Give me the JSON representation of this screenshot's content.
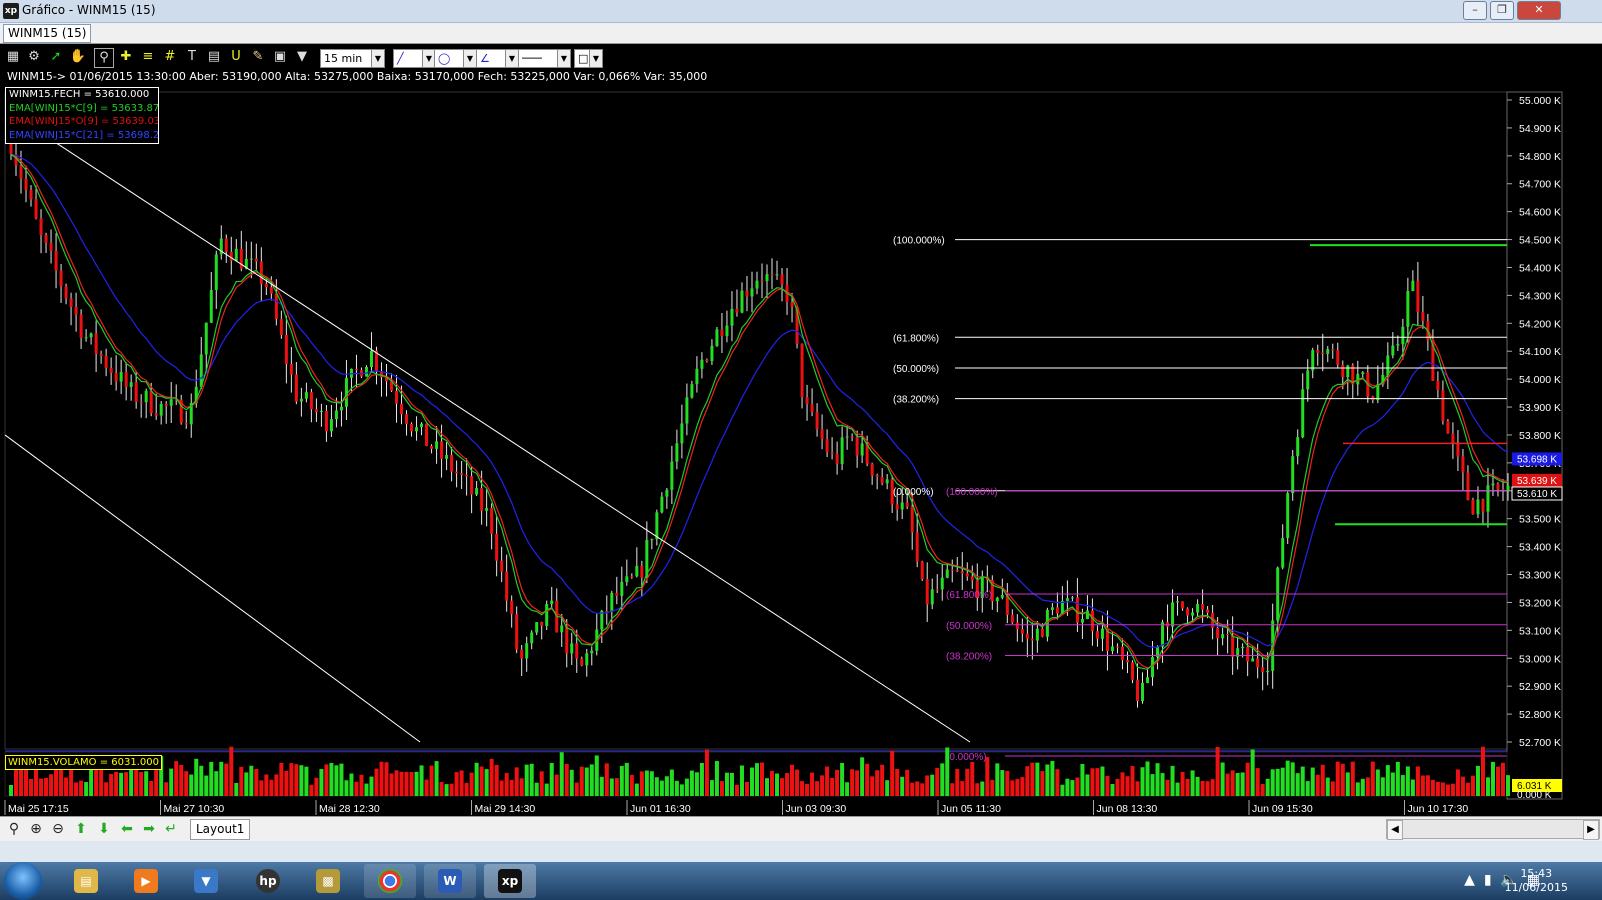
{
  "window": {
    "title": "Gráfico - WINM15 (15)",
    "app_icon": "xp",
    "buttons": [
      "minimize-icon",
      "restore-icon",
      "close-icon"
    ]
  },
  "tab": {
    "label": "WINM15 (15)"
  },
  "toolbar": {
    "interval": "15 min",
    "tools": [
      "chart-type-icon",
      "gear-icon",
      "trend-icon",
      "hand-icon",
      "zoom-icon",
      "crosshair-icon",
      "lines-icon",
      "grid-icon",
      "text-icon",
      "magnet-icon",
      "brush-icon",
      "bag-icon",
      "filter-icon"
    ]
  },
  "info": {
    "line": "WINM15-> 01/06/2015 13:30:00 Aber: 53190,000 Alta: 53275,000 Baixa: 53170,000 Fech: 53225,000 Var: 0,066% Var: 35,000"
  },
  "legend": {
    "items": [
      {
        "text": "WINM15.FECH = 53610.000",
        "color": "#ffffff"
      },
      {
        "text": "EMA[WINJ15*C[9] = 53633.877",
        "color": "#22cc22"
      },
      {
        "text": "EMA[WINJ15*O[9] = 53639.031",
        "color": "#dd1111"
      },
      {
        "text": "EMA[WINJ15*C[21] = 53698.265",
        "color": "#2222dd"
      }
    ]
  },
  "price_axis": {
    "ticks": [
      "55.000 K",
      "54.900 K",
      "54.800 K",
      "54.700 K",
      "54.600 K",
      "54.500 K",
      "54.400 K",
      "54.300 K",
      "54.200 K",
      "54.100 K",
      "54.000 K",
      "53.900 K",
      "53.800 K",
      "53.700 K",
      "53.600 K",
      "53.500 K",
      "53.400 K",
      "53.300 K",
      "53.200 K",
      "53.100 K",
      "53.000 K",
      "52.900 K",
      "52.800 K",
      "52.700 K"
    ],
    "markers": [
      {
        "label": "53.698 K",
        "bg": "#1a1ae6"
      },
      {
        "label": "53.639 K",
        "bg": "#d11"
      },
      {
        "label": "53.610 K",
        "bg": "#000"
      }
    ]
  },
  "fibonacci": {
    "upper": [
      "(100.000%)",
      "(61.800%)",
      "(50.000%)",
      "(38.200%)",
      "(0.000%)"
    ],
    "lower": [
      "(100.000%)",
      "(61.800%)",
      "(50.000%)",
      "(38.200%)",
      "(0.000%)"
    ]
  },
  "volume": {
    "legend": "WINM15.VOLAMO = 6031.000",
    "axis_top": "6.031 K",
    "axis_bottom": "0.000 K"
  },
  "time_axis": {
    "labels": [
      "Mai 25 17:15",
      "Mai 27 10:30",
      "Mai 28 12:30",
      "Mai 29 14:30",
      "Jun 01 16:30",
      "Jun 03 09:30",
      "Jun 05 11:30",
      "Jun 08 13:30",
      "Jun 09 15:30",
      "Jun 10 17:30"
    ]
  },
  "statusbar": {
    "layout_tab": "Layout1",
    "nav_icons": [
      "zoom-icon",
      "zoom-in-icon",
      "zoom-out-icon",
      "arrow-up-icon",
      "arrow-down-icon",
      "arrow-left-icon",
      "arrow-right-icon",
      "arrow-back-icon"
    ]
  },
  "taskbar": {
    "apps": [
      "file-manager-icon",
      "media-player-icon",
      "network-icon",
      "hp-icon",
      "clipboard-icon",
      "chrome-icon",
      "word-icon",
      "xp-icon"
    ],
    "time": "15:43",
    "date": "11/06/2015"
  },
  "chart_data": {
    "type": "candlestick",
    "instrument": "WINM15",
    "interval": "15 min",
    "ylim": [
      52650,
      55050
    ],
    "price_path": [
      [
        0,
        54850
      ],
      [
        0.02,
        54500
      ],
      [
        0.05,
        54150
      ],
      [
        0.08,
        53950
      ],
      [
        0.1,
        53900
      ],
      [
        0.12,
        53880
      ],
      [
        0.14,
        54500
      ],
      [
        0.17,
        54350
      ],
      [
        0.19,
        53950
      ],
      [
        0.21,
        53850
      ],
      [
        0.24,
        54100
      ],
      [
        0.27,
        53820
      ],
      [
        0.3,
        53650
      ],
      [
        0.32,
        53500
      ],
      [
        0.34,
        52980
      ],
      [
        0.36,
        53180
      ],
      [
        0.38,
        52950
      ],
      [
        0.4,
        53200
      ],
      [
        0.42,
        53300
      ],
      [
        0.44,
        53680
      ],
      [
        0.46,
        54050
      ],
      [
        0.48,
        54250
      ],
      [
        0.5,
        54380
      ],
      [
        0.52,
        54300
      ],
      [
        0.53,
        53900
      ],
      [
        0.55,
        53700
      ],
      [
        0.56,
        53800
      ],
      [
        0.58,
        53650
      ],
      [
        0.6,
        53500
      ],
      [
        0.61,
        53200
      ],
      [
        0.63,
        53300
      ],
      [
        0.66,
        53220
      ],
      [
        0.68,
        53050
      ],
      [
        0.7,
        53200
      ],
      [
        0.72,
        53150
      ],
      [
        0.74,
        53000
      ],
      [
        0.755,
        52850
      ],
      [
        0.77,
        53150
      ],
      [
        0.79,
        53200
      ],
      [
        0.81,
        53050
      ],
      [
        0.83,
        52980
      ],
      [
        0.84,
        53000
      ],
      [
        0.855,
        53700
      ],
      [
        0.87,
        54150
      ],
      [
        0.89,
        54050
      ],
      [
        0.91,
        53950
      ],
      [
        0.925,
        54100
      ],
      [
        0.935,
        54350
      ],
      [
        0.945,
        54150
      ],
      [
        0.96,
        53800
      ],
      [
        0.975,
        53550
      ],
      [
        1,
        53610
      ]
    ],
    "volume_levels": "relative (0-1) heights derived from visual, max 6.031 K"
  }
}
